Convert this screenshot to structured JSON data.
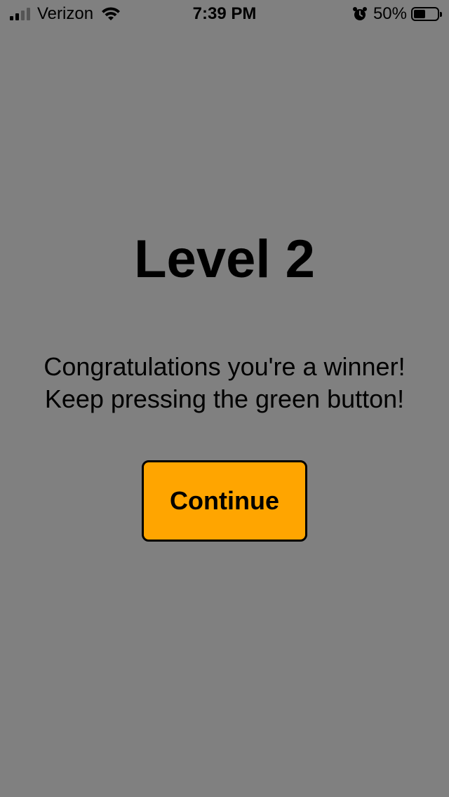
{
  "status_bar": {
    "carrier": "Verizon",
    "time": "7:39 PM",
    "battery_percent_label": "50%",
    "battery_level": 0.5,
    "signal_bars_active": 2,
    "signal_bars_total": 4,
    "icons": [
      "signal-icon",
      "wifi-icon",
      "alarm-icon",
      "battery-icon"
    ]
  },
  "main": {
    "title": "Level 2",
    "message_line1": "Congratulations you're a winner!",
    "message_line2": "Keep pressing the green button!",
    "continue_label": "Continue"
  },
  "colors": {
    "background": "#808080",
    "button": "#FFA500",
    "text": "#000000"
  }
}
